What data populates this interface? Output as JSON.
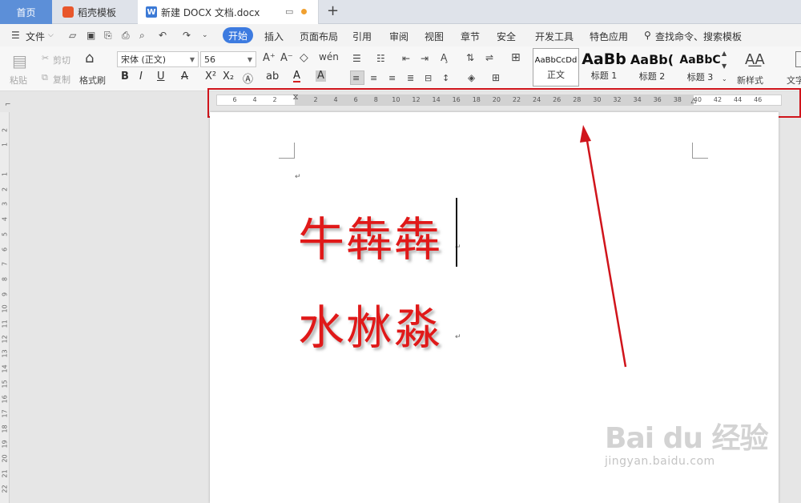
{
  "tabs": {
    "home": "首页",
    "template": "稻壳模板",
    "document": "新建 DOCX 文档.docx",
    "new_tab": "+"
  },
  "menu": {
    "file": "文件",
    "items": [
      "开始",
      "插入",
      "页面布局",
      "引用",
      "审阅",
      "视图",
      "章节",
      "安全",
      "开发工具",
      "特色应用"
    ],
    "search": "查找命令、搜索模板"
  },
  "ribbon": {
    "paste": "粘贴",
    "cut": "剪切",
    "copy": "复制",
    "format_painter": "格式刷",
    "font_name": "宋体 (正文)",
    "font_size": "56",
    "styles": [
      {
        "preview": "AaBbCcDd",
        "name": "正文"
      },
      {
        "preview": "AaBb",
        "name": "标题 1"
      },
      {
        "preview": "AaBb(",
        "name": "标题 2"
      },
      {
        "preview": "AaBbC",
        "name": "标题 3"
      }
    ],
    "new_style": "新样式",
    "text_tool": "文字"
  },
  "ruler": {
    "left_numbers": [
      "6",
      "4",
      "2"
    ],
    "right_numbers": [
      "2",
      "4",
      "6",
      "8",
      "10",
      "12",
      "14",
      "16",
      "18",
      "20",
      "22",
      "24",
      "26",
      "28",
      "30",
      "32",
      "34",
      "36",
      "38",
      "40",
      "42",
      "44",
      "46"
    ]
  },
  "vruler_numbers": [
    "2",
    "1",
    "1",
    "2",
    "3",
    "4",
    "5",
    "6",
    "7",
    "8",
    "9",
    "10",
    "11",
    "12",
    "13",
    "14",
    "15",
    "16",
    "17",
    "18",
    "19",
    "20",
    "21",
    "22"
  ],
  "document": {
    "line1": "牛犇犇",
    "line2": "水沝淼"
  },
  "colors": {
    "accent": "#3d7be0",
    "text_red": "#e01919",
    "highlight_box": "#d0141b"
  },
  "watermark": {
    "logo": "Bai du 经验",
    "url": "jingyan.baidu.com"
  }
}
